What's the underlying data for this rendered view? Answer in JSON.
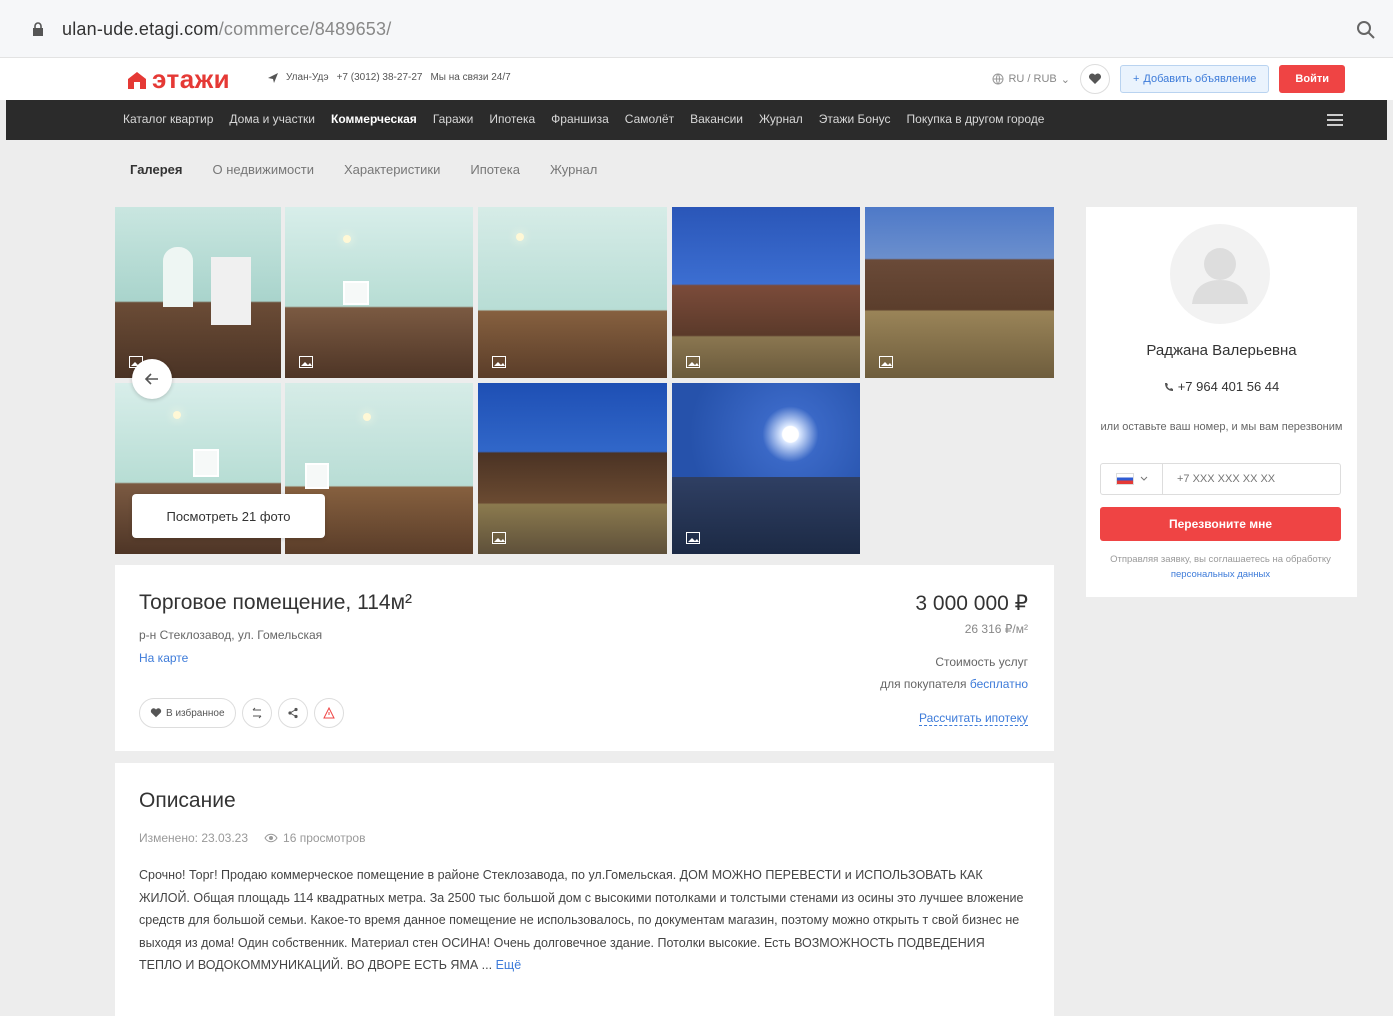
{
  "browser": {
    "url_host": "ulan-ude.etagi.com",
    "url_path": "/commerce/8489653/"
  },
  "header": {
    "logo_text": "этажи",
    "city": "Улан-Удэ",
    "phone": "+7 (3012) 38-27-27",
    "hours": "Мы на связи 24/7",
    "language": "RU / RUB",
    "add_ad_label": "Добавить объявление",
    "login_label": "Войти"
  },
  "nav": {
    "items": [
      "Каталог квартир",
      "Дома и участки",
      "Коммерческая",
      "Гаражи",
      "Ипотека",
      "Франшиза",
      "Самолёт",
      "Вакансии",
      "Журнал",
      "Этажи Бонус",
      "Покупка в другом городе"
    ],
    "active": "Коммерческая"
  },
  "subtabs": [
    "Галерея",
    "О недвижимости",
    "Характеристики",
    "Ипотека",
    "Журнал"
  ],
  "gallery": {
    "more_label": "Посмотреть 21 фото"
  },
  "listing": {
    "title": "Торговое помещение, 114м²",
    "address": "р-н Стеклозавод, ул. Гомельская",
    "map_link": "На карте",
    "price": "3 000 000 ₽",
    "price_per_m2": "26 316 ₽/м²",
    "service_line1": "Стоимость услуг",
    "service_line2_prefix": "для покупателя ",
    "service_free": "бесплатно",
    "mortgage_link": "Рассчитать ипотеку",
    "favorite_label": "В избранное"
  },
  "description": {
    "heading": "Описание",
    "changed": "Изменено: 23.03.23",
    "views": "16 просмотров",
    "text": "Срочно! Торг! Продаю коммерческое помещение в районе Стеклозавода, по ул.Гомельская. ДОМ МОЖНО ПЕРЕВЕСТИ и ИСПОЛЬЗОВАТЬ КАК ЖИЛОЙ. Общая площадь 114 квадратных метра. За 2500 тыс большой дом с высокими потолками и толстыми стенами из осины это лучшее вложение средств для большой семьи. Какое-то время данное помещение не использовалось, по документам магазин, поэтому можно открыть т свой бизнес не выходя из дома! Один собственник. Материал стен ОСИНА! Очень долговечное здание. Потолки высокие. Есть ВОЗМОЖНОСТЬ ПОДВЕДЕНИЯ ТЕПЛО И ВОДОКОММУНИКАЦИЙ. ВО ДВОРЕ ЕСТЬ ЯМА ... ",
    "more": "Ещё"
  },
  "contact": {
    "name": "Раджана Валерьевна",
    "phone": "+7 964 401 56 44",
    "hint": "или оставьте ваш номер, и мы вам перезвоним",
    "phone_placeholder": "+7 XXX XXX XX XX",
    "call_label": "Перезвоните мне",
    "consent_prefix": "Отправляя заявку, вы соглашаетесь на обработку ",
    "consent_link": "персональных данных"
  },
  "colors": {
    "brand_red": "#ef4444",
    "link_blue": "#3d7bd9",
    "nav_bg": "#2b2b2b"
  }
}
